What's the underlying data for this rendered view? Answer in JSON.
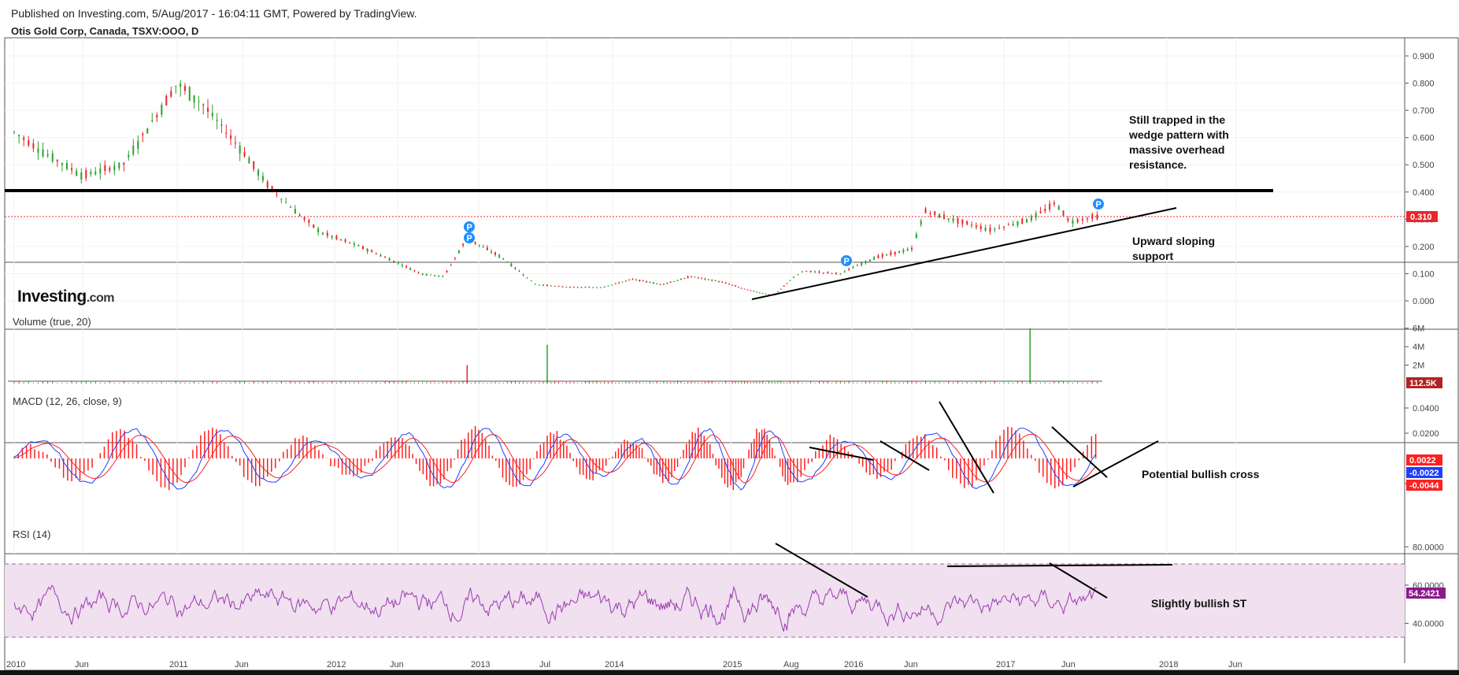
{
  "header": {
    "published": "Published on Investing.com, 5/Aug/2017 - 16:04:11 GMT, Powered by TradingView.",
    "symbol": "Otis Gold Corp, Canada, TSXV:OOO, D"
  },
  "logo": {
    "brand": "Investing",
    "suffix": ".com"
  },
  "colors": {
    "up": "#2ca02c",
    "down": "#e8262d",
    "macd": "#1f3fff",
    "signal": "#ff2020",
    "rsi": "#9b3ab0",
    "rsi_band": "#f0e0f0",
    "badge": "#1e90ff"
  },
  "chart_data": [
    {
      "type": "candlestick",
      "title": "Otis Gold Corp, Canada, TSXV:OOO, D",
      "ylim": [
        0.0,
        0.9
      ],
      "y_ticks": [
        "0.900",
        "0.800",
        "0.700",
        "0.600",
        "0.500",
        "0.400",
        "0.300",
        "0.200",
        "0.100",
        "0.000"
      ],
      "x_ticks": [
        "2010",
        "Jun",
        "2011",
        "Jun",
        "2012",
        "Jun",
        "2013",
        "Jul",
        "2014",
        "2015",
        "Aug",
        "2016",
        "Jun",
        "2017",
        "Jun",
        "2018",
        "Jun"
      ],
      "series": [
        {
          "name": "price (approx. closes)",
          "dates": [
            "2010-01",
            "2010-03",
            "2010-06",
            "2010-09",
            "2010-12",
            "2011-01",
            "2011-03",
            "2011-06",
            "2011-08",
            "2011-10",
            "2011-12",
            "2012-03",
            "2012-06",
            "2012-08",
            "2012-10",
            "2012-12",
            "2013-03",
            "2013-06",
            "2013-09",
            "2013-12",
            "2014-03",
            "2014-06",
            "2014-09",
            "2014-12",
            "2015-03",
            "2015-06",
            "2015-09",
            "2015-12",
            "2016-03",
            "2016-06",
            "2016-07",
            "2016-09",
            "2016-12",
            "2017-03",
            "2017-05",
            "2017-06",
            "2017-08"
          ],
          "values": [
            0.62,
            0.55,
            0.46,
            0.5,
            0.72,
            0.8,
            0.72,
            0.55,
            0.42,
            0.33,
            0.25,
            0.2,
            0.14,
            0.1,
            0.09,
            0.23,
            0.16,
            0.06,
            0.05,
            0.05,
            0.08,
            0.06,
            0.09,
            0.07,
            0.04,
            0.02,
            0.11,
            0.1,
            0.16,
            0.19,
            0.33,
            0.3,
            0.26,
            0.3,
            0.36,
            0.29,
            0.31
          ]
        }
      ],
      "last_price": "0.310",
      "horizontal_line": 0.4,
      "annotations": [
        "Still trapped in the",
        "wedge pattern with",
        "massive overhead",
        "resistance.",
        "Upward sloping",
        "support"
      ],
      "markers": [
        "P",
        "P",
        "P",
        "P"
      ]
    },
    {
      "type": "bar",
      "title": "Volume (true, 20)",
      "y_ticks": [
        "6M",
        "4M",
        "2M"
      ],
      "last_value": "112.5K",
      "spikes": [
        {
          "date": "2012-12",
          "value": 2000000
        },
        {
          "date": "2013-07",
          "value": 4200000
        },
        {
          "date": "2017-03",
          "value": 6000000
        }
      ]
    },
    {
      "type": "line",
      "title": "MACD (12, 26, close, 9)",
      "ylim": [
        -0.03,
        0.045
      ],
      "y_ticks": [
        "0.0400",
        "0.0200",
        "-0.0200"
      ],
      "values_shown": [
        "0.0022",
        "-0.0022",
        "-0.0044"
      ],
      "annotations": [
        "Potential bullish cross"
      ]
    },
    {
      "type": "line",
      "title": "RSI (14)",
      "ylim": [
        20,
        90
      ],
      "y_ticks": [
        "80.0000",
        "60.0000",
        "40.0000"
      ],
      "bands": [
        70,
        30
      ],
      "last_value": "54.2421",
      "annotations": [
        "Slightly bullish  ST"
      ]
    }
  ]
}
